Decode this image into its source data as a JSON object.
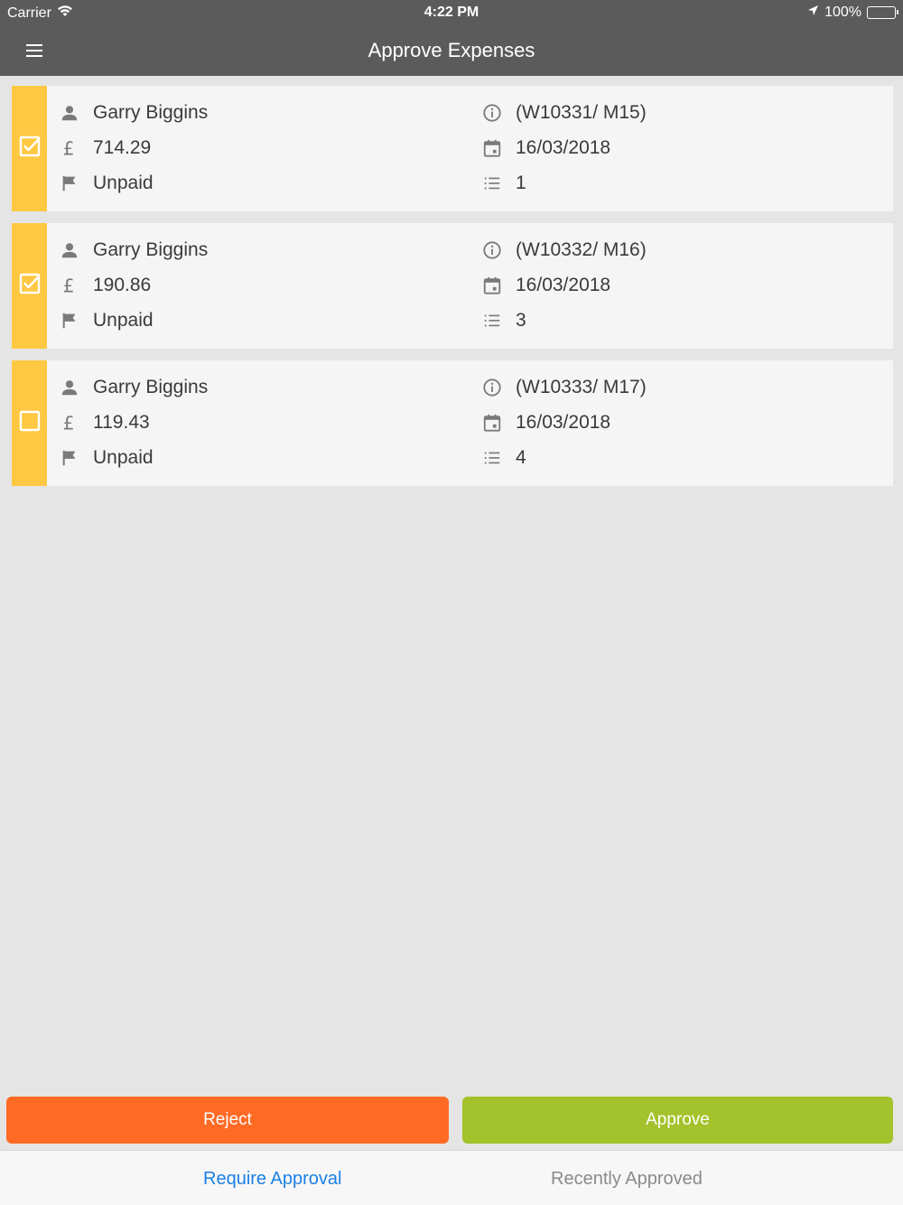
{
  "status_bar": {
    "carrier": "Carrier",
    "time": "4:22 PM",
    "battery": "100%"
  },
  "header": {
    "title": "Approve Expenses"
  },
  "expenses": [
    {
      "checked": true,
      "name": "Garry Biggins",
      "amount": "714.29",
      "status": "Unpaid",
      "reference": "(W10331/ M15)",
      "date": "16/03/2018",
      "items": "1"
    },
    {
      "checked": true,
      "name": "Garry Biggins",
      "amount": "190.86",
      "status": "Unpaid",
      "reference": "(W10332/ M16)",
      "date": "16/03/2018",
      "items": "3"
    },
    {
      "checked": false,
      "name": "Garry Biggins",
      "amount": "119.43",
      "status": "Unpaid",
      "reference": "(W10333/ M17)",
      "date": "16/03/2018",
      "items": "4"
    }
  ],
  "actions": {
    "reject_label": "Reject",
    "approve_label": "Approve"
  },
  "tabs": {
    "require_approval": "Require Approval",
    "recently_approved": "Recently Approved"
  },
  "colors": {
    "header_bg": "#5b5b5b",
    "card_strip": "#ffc842",
    "reject": "#ff6a24",
    "approve": "#a3c22b",
    "active_tab": "#1a7fe5"
  }
}
